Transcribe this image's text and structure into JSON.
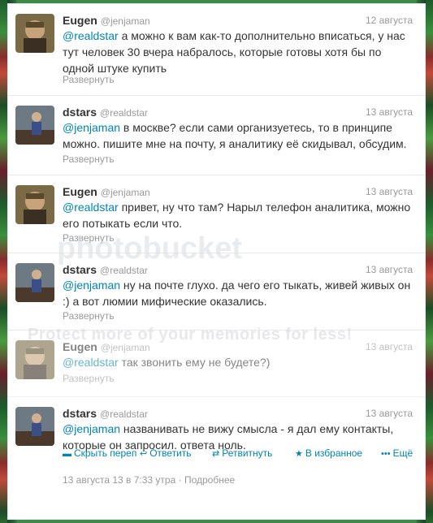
{
  "tweets": [
    {
      "name": "Eugen",
      "handle": "@jenjaman",
      "date": "12 августа",
      "mention": "@realdstar",
      "text": " а можно к вам как-то дополнительно вписаться, у нас тут человек 30 вчера набралось, которые готовы хотя бы по одной штуке купить",
      "expand": "Развернуть"
    },
    {
      "name": "dstars",
      "handle": "@realdstar",
      "date": "13 августа",
      "mention": "@jenjaman",
      "text": " в москве? если сами организуетесь, то в принципе можно. пишите мне на почту, я аналитику её скидывал, обсудим.",
      "expand": "Развернуть"
    },
    {
      "name": "Eugen",
      "handle": "@jenjaman",
      "date": "13 августа",
      "mention": "@realdstar",
      "text": " привет, ну что там? Нарыл телефон аналитика, можно его потыкать если что.",
      "expand": "Развернуть"
    },
    {
      "name": "dstars",
      "handle": "@realdstar",
      "date": "13 августа",
      "mention": "@jenjaman",
      "text": " ну на почте глухо. да чего его тыкать, живей живых он :) а вот люмии мифические оказались.",
      "expand": "Развернуть"
    },
    {
      "name": "Eugen",
      "handle": "@jenjaman",
      "date": "13 августа",
      "mention": "@realdstar",
      "text": " так звонить ему не будете?)",
      "expand": "Развернуть"
    },
    {
      "name": "dstars",
      "handle": "@realdstar",
      "date": "13 августа",
      "mention": "@jenjaman",
      "text": " названивать не вижу смысла - я дал ему контакты, которые он запросил. ответа ноль."
    }
  ],
  "actions": {
    "hide": "Скрыть переписку",
    "reply": "Ответить",
    "retweet": "Ретвитнуть",
    "favorite": "В избранное",
    "more": "Ещё"
  },
  "meta": {
    "timestamp": "13 августа 13 в 7:33 утра",
    "separator": " · ",
    "details": "Подробнее"
  },
  "watermark": {
    "logo": "photobucket",
    "text": "Protect more of your memories for less!"
  },
  "colors": {
    "link": "#0084b4",
    "muted": "#999999",
    "text": "#333333"
  }
}
